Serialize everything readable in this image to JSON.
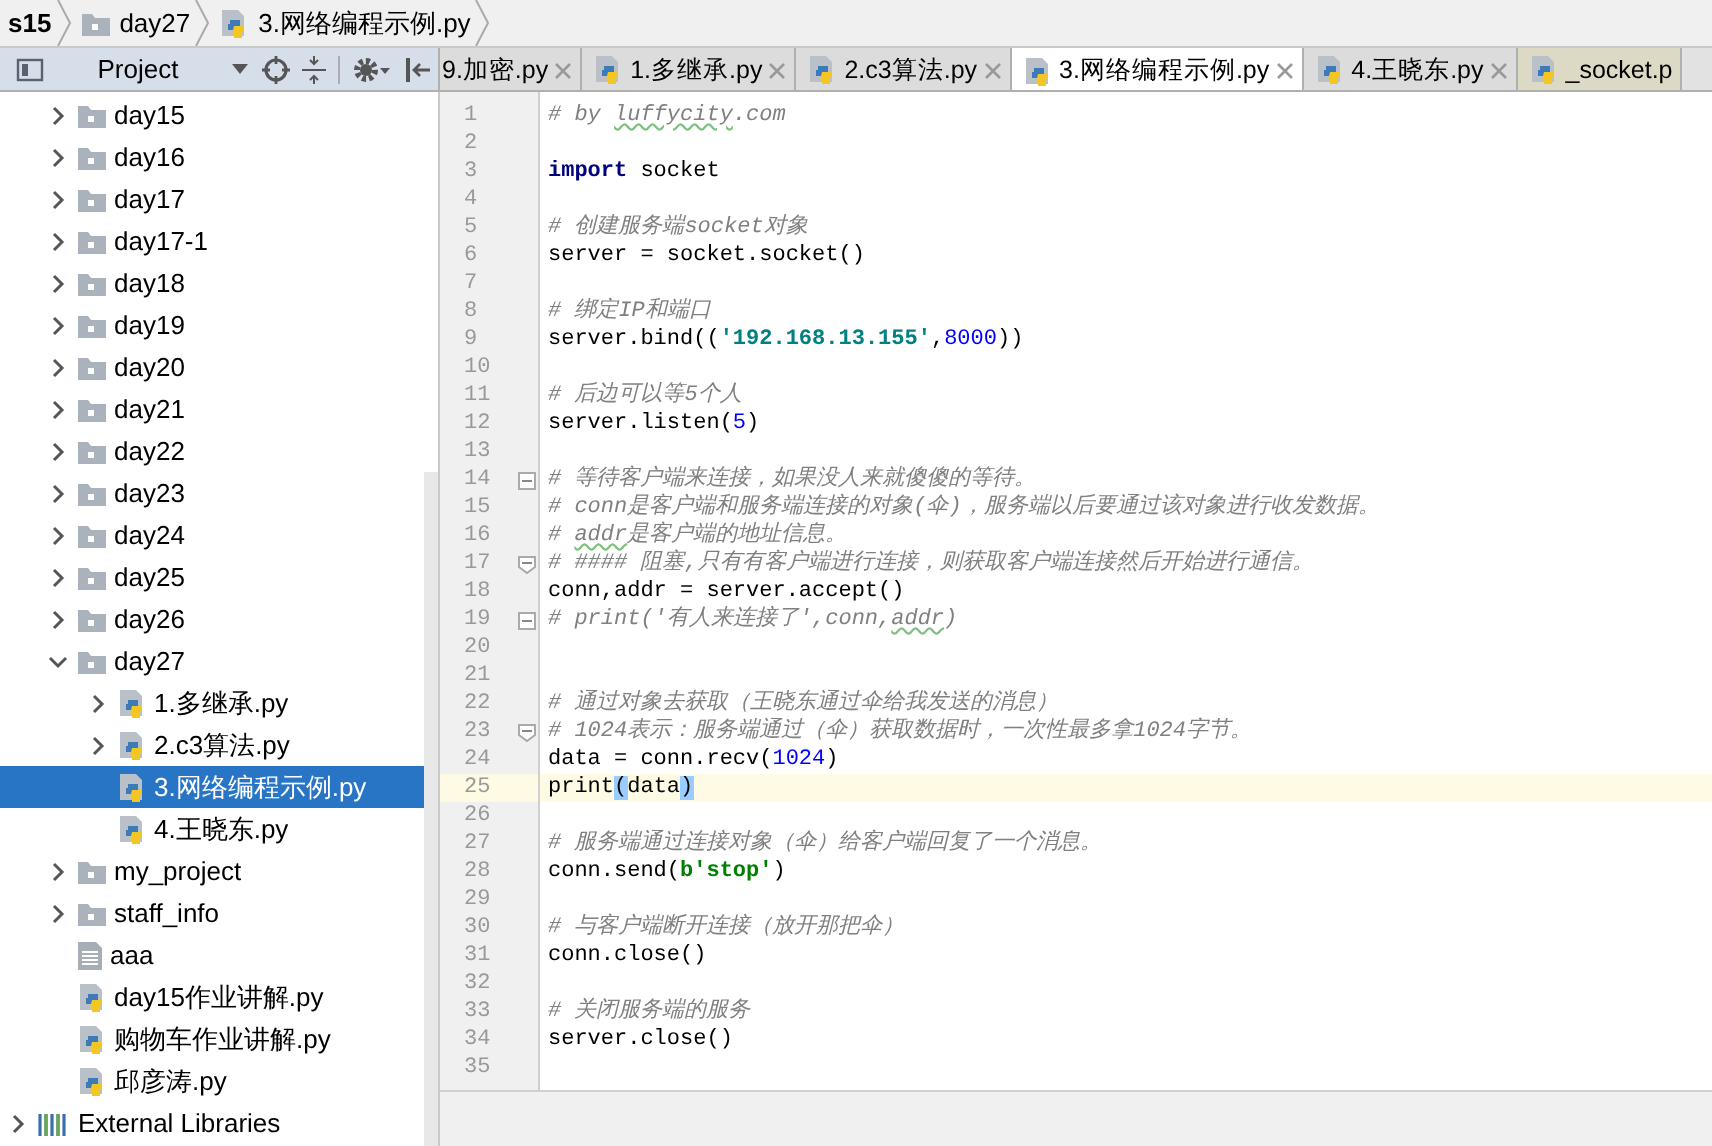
{
  "breadcrumb": [
    {
      "label": "s15",
      "kind": "project"
    },
    {
      "label": "day27",
      "kind": "folder"
    },
    {
      "label": "3.网络编程示例.py",
      "kind": "python"
    }
  ],
  "project_panel": {
    "title": "Project"
  },
  "tabs": [
    {
      "label": "9.加密.py",
      "selected": false,
      "cut_left": true,
      "kind": "python"
    },
    {
      "label": "1.多继承.py",
      "selected": false,
      "kind": "python"
    },
    {
      "label": "2.c3算法.py",
      "selected": false,
      "kind": "python"
    },
    {
      "label": "3.网络编程示例.py",
      "selected": true,
      "kind": "python"
    },
    {
      "label": "4.王晓东.py",
      "selected": false,
      "kind": "python"
    },
    {
      "label": "_socket.p",
      "selected": false,
      "cut_right": true,
      "kind": "library"
    }
  ],
  "tree": {
    "scrolled_parent_children": [
      {
        "label": "day15",
        "kind": "folder",
        "expanded": false
      },
      {
        "label": "day16",
        "kind": "folder",
        "expanded": false
      },
      {
        "label": "day17",
        "kind": "folder",
        "expanded": false
      },
      {
        "label": "day17-1",
        "kind": "folder",
        "expanded": false
      },
      {
        "label": "day18",
        "kind": "folder",
        "expanded": false
      },
      {
        "label": "day19",
        "kind": "folder",
        "expanded": false
      },
      {
        "label": "day20",
        "kind": "folder",
        "expanded": false
      },
      {
        "label": "day21",
        "kind": "folder",
        "expanded": false
      },
      {
        "label": "day22",
        "kind": "folder",
        "expanded": false
      },
      {
        "label": "day23",
        "kind": "folder",
        "expanded": false
      },
      {
        "label": "day24",
        "kind": "folder",
        "expanded": false
      },
      {
        "label": "day25",
        "kind": "folder",
        "expanded": false
      },
      {
        "label": "day26",
        "kind": "folder",
        "expanded": false
      },
      {
        "label": "day27",
        "kind": "folder",
        "expanded": true,
        "children": [
          {
            "label": "1.多继承.py",
            "kind": "python",
            "expanded": false,
            "selected": false
          },
          {
            "label": "2.c3算法.py",
            "kind": "python",
            "expanded": false,
            "selected": false
          },
          {
            "label": "3.网络编程示例.py",
            "kind": "python",
            "selected": true
          },
          {
            "label": "4.王晓东.py",
            "kind": "python",
            "selected": false
          }
        ]
      },
      {
        "label": "my_project",
        "kind": "folder",
        "expanded": false
      },
      {
        "label": "staff_info",
        "kind": "folder",
        "expanded": false
      },
      {
        "label": "aaa",
        "kind": "text"
      },
      {
        "label": "day15作业讲解.py",
        "kind": "python"
      },
      {
        "label": "购物车作业讲解.py",
        "kind": "python"
      },
      {
        "label": "邱彦涛.py",
        "kind": "python"
      }
    ],
    "roots": [
      {
        "label": "External Libraries",
        "kind": "library",
        "expanded": false
      }
    ]
  },
  "editor": {
    "lines": [
      {
        "number": "1",
        "tokens": [
          {
            "kind": "comment",
            "text": "# by "
          },
          {
            "kind": "comment-typo",
            "text": "luffycity"
          },
          {
            "kind": "comment",
            "text": ".com"
          }
        ]
      },
      {
        "number": "2"
      },
      {
        "number": "3",
        "tokens": [
          {
            "kind": "keyword",
            "text": "import"
          },
          {
            "kind": "plain",
            "text": " socket"
          }
        ]
      },
      {
        "number": "4"
      },
      {
        "number": "5",
        "tokens": [
          {
            "kind": "comment",
            "text": "# 创建服务端socket对象"
          }
        ]
      },
      {
        "number": "6",
        "tokens": [
          {
            "kind": "plain",
            "text": "server = socket.socket()"
          }
        ]
      },
      {
        "number": "7"
      },
      {
        "number": "8",
        "tokens": [
          {
            "kind": "comment",
            "text": "# 绑定IP和端口"
          }
        ]
      },
      {
        "number": "9",
        "tokens": [
          {
            "kind": "plain",
            "text": "server.bind(("
          },
          {
            "kind": "string",
            "text": "'192.168.13.155'"
          },
          {
            "kind": "plain",
            "text": ","
          },
          {
            "kind": "number",
            "text": "8000"
          },
          {
            "kind": "plain",
            "text": "))"
          }
        ]
      },
      {
        "number": "10"
      },
      {
        "number": "11",
        "tokens": [
          {
            "kind": "comment",
            "text": "# 后边可以等5个人"
          }
        ]
      },
      {
        "number": "12",
        "tokens": [
          {
            "kind": "plain",
            "text": "server.listen("
          },
          {
            "kind": "number",
            "text": "5"
          },
          {
            "kind": "plain",
            "text": ")"
          }
        ]
      },
      {
        "number": "13"
      },
      {
        "number": "14",
        "fold_start": true,
        "tokens": [
          {
            "kind": "comment",
            "text": "# 等待客户端来连接，如果没人来就傻傻的等待。"
          }
        ]
      },
      {
        "number": "15",
        "tokens": [
          {
            "kind": "comment",
            "text": "# conn是客户端和服务端连接的对象(伞)，服务端以后要通过该对象进行收发数据。"
          }
        ]
      },
      {
        "number": "16",
        "tokens": [
          {
            "kind": "comment",
            "text": "# "
          },
          {
            "kind": "comment-typo",
            "text": "addr"
          },
          {
            "kind": "comment",
            "text": "是客户端的地址信息。"
          }
        ]
      },
      {
        "number": "17",
        "fold_end": true,
        "tokens": [
          {
            "kind": "comment",
            "text": "# #### 阻塞,只有有客户端进行连接，则获取客户端连接然后开始进行通信。"
          }
        ]
      },
      {
        "number": "18",
        "tokens": [
          {
            "kind": "plain",
            "text": "conn,addr = server.accept()"
          }
        ]
      },
      {
        "number": "19",
        "fold_start": true,
        "tokens": [
          {
            "kind": "comment",
            "text": "# print('有人来连接了',conn,"
          },
          {
            "kind": "comment-typo",
            "text": "addr"
          },
          {
            "kind": "comment",
            "text": ")"
          }
        ]
      },
      {
        "number": "20"
      },
      {
        "number": "21"
      },
      {
        "number": "22",
        "tokens": [
          {
            "kind": "comment",
            "text": "# 通过对象去获取（王晓东通过伞给我发送的消息）"
          }
        ]
      },
      {
        "number": "23",
        "fold_end": true,
        "tokens": [
          {
            "kind": "comment",
            "text": "# 1024表示：服务端通过（伞）获取数据时，一次性最多拿1024字节。"
          }
        ]
      },
      {
        "number": "24",
        "tokens": [
          {
            "kind": "plain",
            "text": "data = conn.recv("
          },
          {
            "kind": "number",
            "text": "1024"
          },
          {
            "kind": "plain",
            "text": ")"
          }
        ]
      },
      {
        "number": "25",
        "current": true,
        "tokens": [
          {
            "kind": "plain",
            "text": "print"
          },
          {
            "kind": "brace-match",
            "text": "("
          },
          {
            "kind": "plain",
            "text": "data"
          },
          {
            "kind": "brace-match",
            "text": ")"
          }
        ]
      },
      {
        "number": "26"
      },
      {
        "number": "27",
        "tokens": [
          {
            "kind": "comment",
            "text": "# 服务端通过连接对象（伞）给客户端回复了一个消息。"
          }
        ]
      },
      {
        "number": "28",
        "tokens": [
          {
            "kind": "plain",
            "text": "conn.send("
          },
          {
            "kind": "bytes",
            "text": "b'stop'"
          },
          {
            "kind": "plain",
            "text": ")"
          }
        ]
      },
      {
        "number": "29"
      },
      {
        "number": "30",
        "tokens": [
          {
            "kind": "comment",
            "text": "# 与客户端断开连接（放开那把伞）"
          }
        ]
      },
      {
        "number": "31",
        "tokens": [
          {
            "kind": "plain",
            "text": "conn.close()"
          }
        ]
      },
      {
        "number": "32"
      },
      {
        "number": "33",
        "tokens": [
          {
            "kind": "comment",
            "text": "# 关闭服务端的服务"
          }
        ]
      },
      {
        "number": "34",
        "tokens": [
          {
            "kind": "plain",
            "text": "server.close()"
          }
        ]
      },
      {
        "number": "35"
      }
    ]
  }
}
